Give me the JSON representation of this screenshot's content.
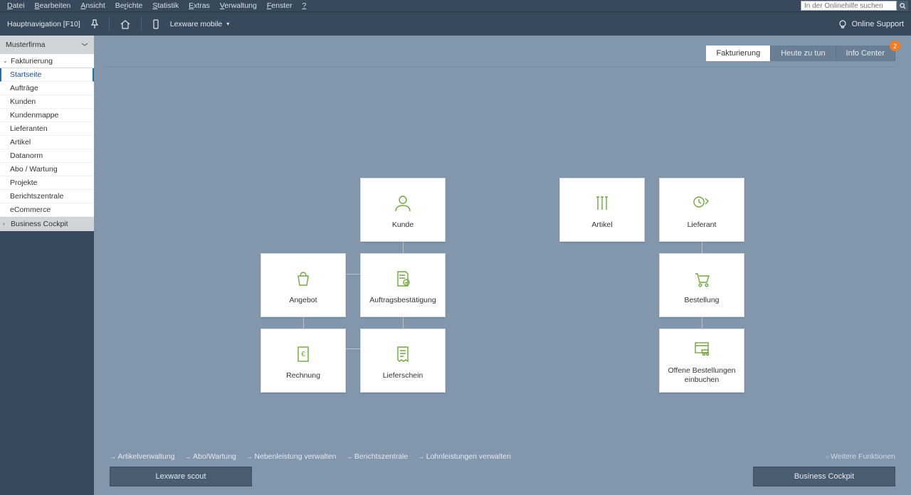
{
  "menubar": {
    "items": [
      {
        "u": "D",
        "rest": "atei"
      },
      {
        "u": "B",
        "rest": "earbeiten"
      },
      {
        "u": "A",
        "rest": "nsicht"
      },
      {
        "u": "",
        "rest": "Be",
        "u2": "r",
        "rest2": "ichte"
      },
      {
        "u": "S",
        "rest": "tatistik"
      },
      {
        "u": "E",
        "rest": "xtras"
      },
      {
        "u": "V",
        "rest": "erwaltung"
      },
      {
        "u": "F",
        "rest": "enster"
      },
      {
        "u": "?",
        "rest": ""
      }
    ],
    "search_placeholder": "In der Onlinehilfe suchen"
  },
  "toolbar": {
    "nav_label": "Hauptnavigation [F10]",
    "mobile_label": "Lexware mobile",
    "online_support": "Online Support"
  },
  "sidebar": {
    "company": "Musterfirma",
    "section1": "Fakturierung",
    "items": [
      "Startseite",
      "Aufträge",
      "Kunden",
      "Kundenmappe",
      "Lieferanten",
      "Artikel",
      "Datanorm",
      "Abo / Wartung",
      "Projekte",
      "Berichtszentrale",
      "eCommerce"
    ],
    "section2": "Business Cockpit"
  },
  "tabs": {
    "t1": "Fakturierung",
    "t2": "Heute zu tun",
    "t3": "Info Center",
    "badge": "2"
  },
  "tiles": {
    "kunde": "Kunde",
    "artikel": "Artikel",
    "lieferant": "Lieferant",
    "angebot": "Angebot",
    "auftrag": "Auftragsbestätigung",
    "bestellung": "Bestellung",
    "rechnung": "Rechnung",
    "lieferschein": "Lieferschein",
    "offene": "Offene Bestellungen einbuchen"
  },
  "bottom_links": [
    "Artikelverwaltung",
    "Abo/Wartung",
    "Nebenleistung verwalten",
    "Berichtszentrale",
    "Lohnleistungen verwalten"
  ],
  "bottom_more": "Weitere Funktionen",
  "bottom_btns": {
    "scout": "Lexware scout",
    "cockpit": "Business Cockpit"
  }
}
